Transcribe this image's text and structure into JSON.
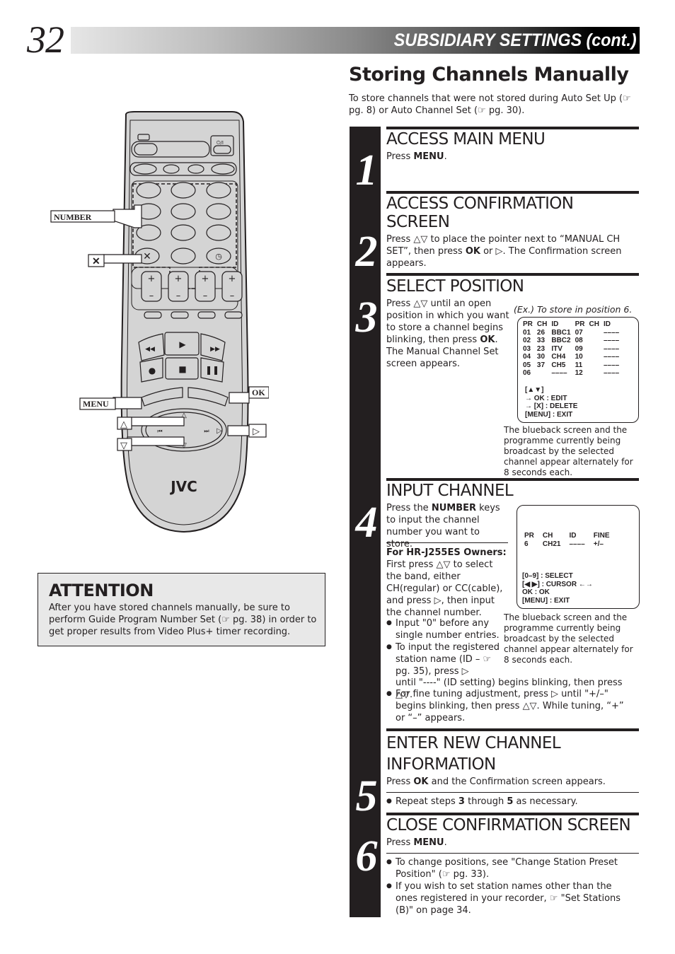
{
  "header": {
    "page_number": "32",
    "title": "SUBSIDIARY SETTINGS (cont.)",
    "bar_gradient": [
      "#e6e6e6",
      "#000000"
    ]
  },
  "section": {
    "title": "Storing Channels Manually",
    "intro": "To store channels that were not stored during Auto Set Up (☞ pg. 8) or Auto Channel Set (☞ pg. 30)."
  },
  "steps": [
    {
      "number": "1",
      "title": "ACCESS MAIN MENU",
      "text_pre": "Press ",
      "text_bold": "MENU",
      "text_post": "."
    },
    {
      "number": "2",
      "title_line1": "ACCESS CONFIRMATION",
      "title_line2": "SCREEN",
      "text_pre": "Press △▽ to place the pointer next to “MANUAL CH SET”, then press ",
      "text_bold": "OK",
      "text_post": " or ▷. The Confirmation screen appears."
    },
    {
      "number": "3",
      "title": "SELECT POSITION",
      "text_pre": "Press △▽ until an open position in which you want to store a channel begins blinking, then press ",
      "text_bold": "OK",
      "text_post": ". The Manual Channel Set screen appears."
    },
    {
      "number": "4",
      "title": "INPUT CHANNEL",
      "text_pre": "Press the ",
      "text_bold": "NUMBER",
      "text_post": " keys to input the channel number you want to store.",
      "owners_heading": "For HR-J255ES Owners:",
      "owners_text": "First press △▽ to select the band, either CH(regular) or CC(cable), and press ▷, then input the channel number.",
      "bullets": [
        "Input \"0\" before any single number entries.",
        "To input the registered station name (ID – ☞ pg. 35), press ▷",
        "until \"----\" (ID setting) begins blinking, then press △▽.",
        "For fine tuning adjustment, press ▷ until \"+/–\" begins blinking, then press  △▽. While tuning, “+” or “–” appears."
      ]
    },
    {
      "number": "5",
      "title_line1": "ENTER NEW CHANNEL",
      "title_line2": "INFORMATION",
      "text_pre": "Press ",
      "text_bold": "OK",
      "text_post": " and the Confirmation screen appears.",
      "note_pre": "Repeat steps ",
      "note_b1": "3",
      "note_mid": " through ",
      "note_b2": "5",
      "note_post": " as necessary."
    },
    {
      "number": "6",
      "title": "CLOSE CONFIRMATION SCREEN",
      "text_pre": "Press ",
      "text_bold": "MENU",
      "text_post": ".",
      "bullets": [
        "To change positions, see \"Change Station Preset Position\" (☞ pg. 33).",
        "If you wish to set station names other than the ones registered in your recorder, ☞ \"Set Stations (B)\" on page 34."
      ]
    }
  ],
  "osd_confirmation": {
    "example_caption": "(Ex.) To store in position 6.",
    "headers": [
      "PR",
      "CH",
      "ID",
      "PR",
      "CH",
      "ID"
    ],
    "rows": [
      [
        "01",
        "26",
        "BBC1",
        "07",
        "",
        "––––"
      ],
      [
        "02",
        "33",
        "BBC2",
        "08",
        "",
        "––––"
      ],
      [
        "03",
        "23",
        "ITV",
        "09",
        "",
        "––––"
      ],
      [
        "04",
        "30",
        "CH4",
        "10",
        "",
        "––––"
      ],
      [
        "05",
        "37",
        "CH5",
        "11",
        "",
        "––––"
      ],
      [
        "06",
        "",
        "––––",
        "12",
        "",
        "––––"
      ]
    ],
    "legend": [
      "[▲▼]",
      "→ OK : EDIT",
      "→ [X] : DELETE",
      "[MENU] : EXIT"
    ],
    "caption": "The blueback screen and the programme currently being broadcast by the selected channel appear alternately for 8 seconds each."
  },
  "osd_manual": {
    "headers": [
      "PR",
      "CH",
      "ID",
      "FINE"
    ],
    "values": [
      "6",
      "CH21",
      "––––",
      "+/–"
    ],
    "legend": [
      "[0–9] : SELECT",
      "[◀ ▶] : CURSOR ←→",
      "OK : OK",
      "[MENU] : EXIT"
    ],
    "caption": "The blueback screen and the programme currently being broadcast by the selected channel appear alternately for 8 seconds each."
  },
  "attention": {
    "title": "ATTENTION",
    "text": "After you have stored channels manually, be sure to perform Guide Program Number Set (☞ pg. 38) in order to get proper results from Video Plus+ timer recording."
  },
  "remote": {
    "brand": "JVC",
    "callouts": {
      "number": "NUMBER",
      "cancel": "✕",
      "menu": "MENU",
      "ok": "OK",
      "up": "△",
      "down": "▽",
      "right": "▷"
    },
    "body_color": "#d4d4d4"
  }
}
